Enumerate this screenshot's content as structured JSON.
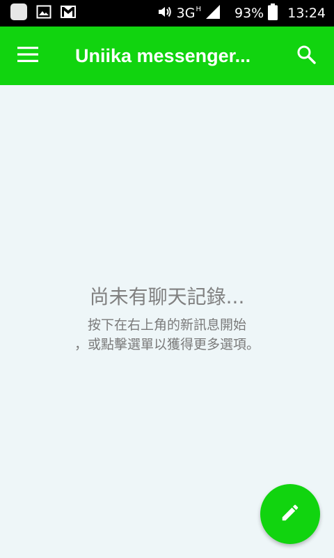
{
  "status_bar": {
    "icons_left": [
      "blank-app-icon",
      "gallery-icon",
      "gmail-icon"
    ],
    "volume_icon": "volume-icon",
    "network": "3G",
    "network_sup": "H",
    "signal_icon": "signal-icon",
    "battery_percent": "93%",
    "battery_icon": "battery-icon",
    "time": "13:24"
  },
  "app_bar": {
    "title": "Uniika messenger...",
    "menu_icon": "hamburger-menu-icon",
    "search_icon": "search-icon",
    "color": "#11d40f"
  },
  "empty_state": {
    "title": "尚未有聊天記錄...",
    "line1": "按下在右上角的新訊息開始",
    "line2": "，或點擊選單以獲得更多選項。"
  },
  "fab": {
    "icon": "pencil-icon"
  },
  "colors": {
    "accent": "#11d40f",
    "background": "#eef6f8",
    "status_bar": "#000000"
  }
}
